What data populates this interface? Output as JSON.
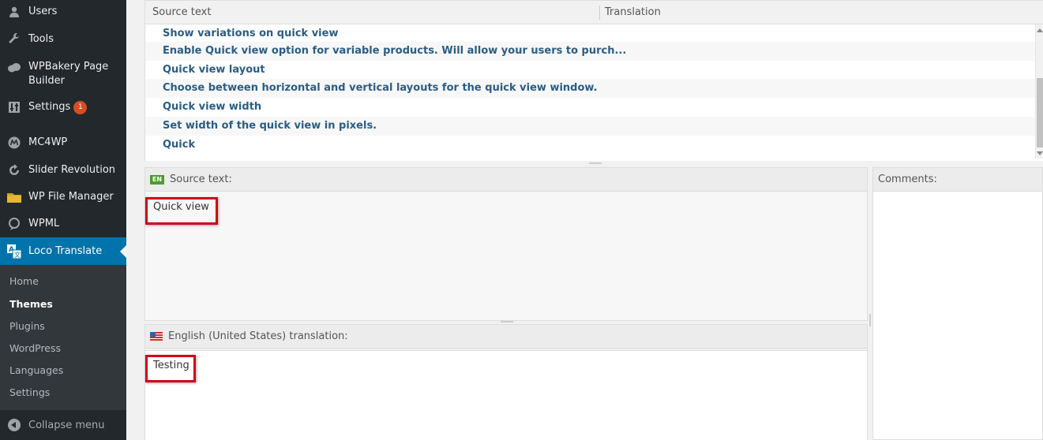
{
  "sidebar": {
    "items": [
      {
        "label": "Users",
        "icon": "users-icon"
      },
      {
        "label": "Tools",
        "icon": "wrench-icon"
      },
      {
        "label": "WPBakery Page Builder",
        "icon": "cloud-icon"
      },
      {
        "label": "Settings",
        "icon": "settings-icon",
        "badge": "1"
      },
      {
        "label": "MC4WP",
        "icon": "mc4wp-icon"
      },
      {
        "label": "Slider Revolution",
        "icon": "refresh-icon"
      },
      {
        "label": "WP File Manager",
        "icon": "folder-icon"
      },
      {
        "label": "WPML",
        "icon": "wpml-icon"
      },
      {
        "label": "Loco Translate",
        "icon": "translate-icon",
        "active": true
      }
    ],
    "wpbakery_line1": "WPBakery Page",
    "wpbakery_line2": "Builder",
    "submenu": [
      "Home",
      "Themes",
      "Plugins",
      "WordPress",
      "Languages",
      "Settings"
    ],
    "submenu_current": "Themes",
    "collapse_label": "Collapse menu"
  },
  "grid": {
    "col_source": "Source text",
    "col_translation": "Translation",
    "rows": [
      "Show variations on quick view",
      "Enable Quick view option for variable products. Will allow your users to purch...",
      "Quick view layout",
      "Choose between horizontal and vertical layouts for the quick view window.",
      "Quick view width",
      "Set width of the quick view in pixels.",
      "Quick"
    ]
  },
  "source_panel": {
    "lang_code": "EN",
    "label": "Source text:",
    "text": "Quick view"
  },
  "translation_panel": {
    "label": "English (United States) translation:",
    "text": "Testing"
  },
  "comments_panel": {
    "label": "Comments:"
  },
  "colors": {
    "sidebar_bg": "#23282d",
    "active_bg": "#0073aa",
    "row_text": "#2a5d84",
    "highlight": "#d0021b",
    "badge": "#d54e21"
  }
}
